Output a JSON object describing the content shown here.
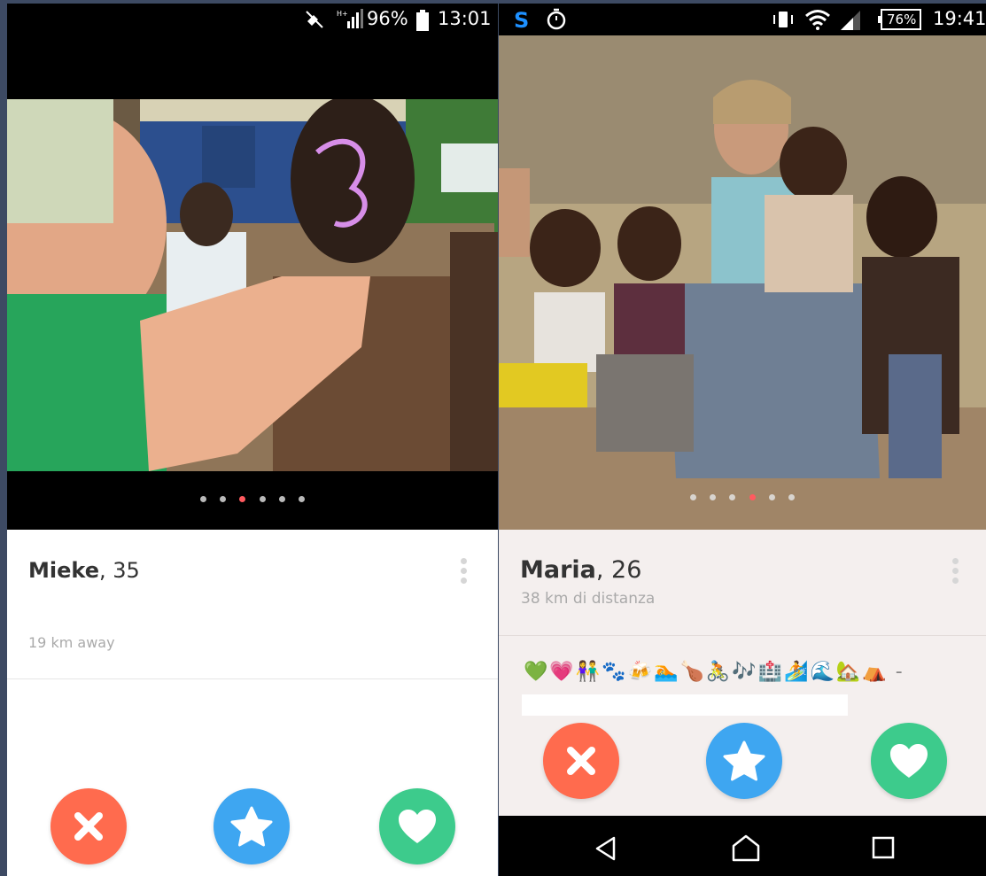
{
  "colors": {
    "pass": "#ff6b4e",
    "super_like": "#3ea6f1",
    "like": "#3dcb8c",
    "dot_active": "#ff5a5f",
    "dot_inactive": "#b9b9b9"
  },
  "left_screen": {
    "status": {
      "battery": "96%",
      "time": "13:01",
      "icons": [
        "mute-icon",
        "signal-icon",
        "battery-icon"
      ]
    },
    "carousel": {
      "count": 6,
      "active_index": 2
    },
    "profile": {
      "name": "Mieke",
      "age": ", 35",
      "distance": "19 km away"
    },
    "actions": [
      "pass-icon",
      "star-icon",
      "heart-icon"
    ]
  },
  "right_screen": {
    "status": {
      "battery": "76%",
      "time": "19:41",
      "icons": [
        "skype-icon",
        "alarm-icon",
        "vibrate-icon",
        "wifi-icon",
        "signal-icon",
        "battery-icon"
      ]
    },
    "carousel": {
      "count": 6,
      "active_index": 3
    },
    "profile": {
      "name": "Maria",
      "age": ", 26",
      "distance": "38 km di distanza",
      "bio_emojis": [
        "💚",
        "💗",
        "👫",
        "🐾",
        "🍻",
        "🏊",
        "🍗",
        "🚴",
        "🎶",
        "🏥",
        "🏄",
        "🌊",
        "🏡",
        "⛺"
      ],
      "bio_trailing": "-"
    },
    "actions": [
      "pass-icon",
      "star-icon",
      "heart-icon"
    ],
    "nav": [
      "back-icon",
      "home-icon",
      "recents-icon"
    ]
  }
}
